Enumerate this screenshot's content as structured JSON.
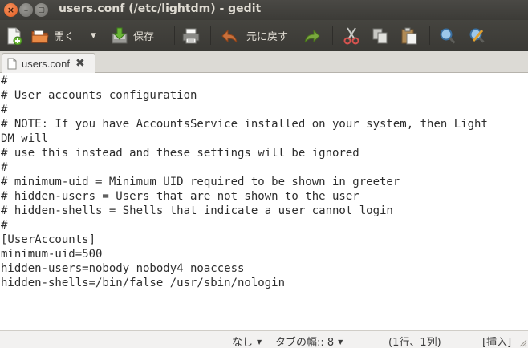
{
  "window": {
    "title": "users.conf (/etc/lightdm) - gedit",
    "close_glyph": "×",
    "min_glyph": "–",
    "max_glyph": "▢"
  },
  "toolbar": {
    "open_label": "開く",
    "open_dropdown": "▼",
    "save_label": "保存",
    "undo_label": "元に戻す"
  },
  "tab": {
    "label": "users.conf",
    "close_glyph": "✖"
  },
  "editor": {
    "lines": [
      "#",
      "# User accounts configuration",
      "#",
      "# NOTE: If you have AccountsService installed on your system, then Light",
      "DM will",
      "# use this instead and these settings will be ignored",
      "#",
      "# minimum-uid = Minimum UID required to be shown in greeter",
      "# hidden-users = Users that are not shown to the user",
      "# hidden-shells = Shells that indicate a user cannot login",
      "#",
      "[UserAccounts]",
      "minimum-uid=500",
      "hidden-users=nobody nobody4 noaccess",
      "hidden-shells=/bin/false /usr/sbin/nologin"
    ]
  },
  "status": {
    "highlight_mode": "なし",
    "tab_width": "タブの幅:: 8",
    "cursor_position": "(1行、1列)",
    "insert_mode": "[挿入]",
    "dropdown_glyph": "▼"
  },
  "colors": {
    "titlebar": "#3c3b37",
    "editor_bg": "#ffffff",
    "close_button": "#e05a1f"
  }
}
